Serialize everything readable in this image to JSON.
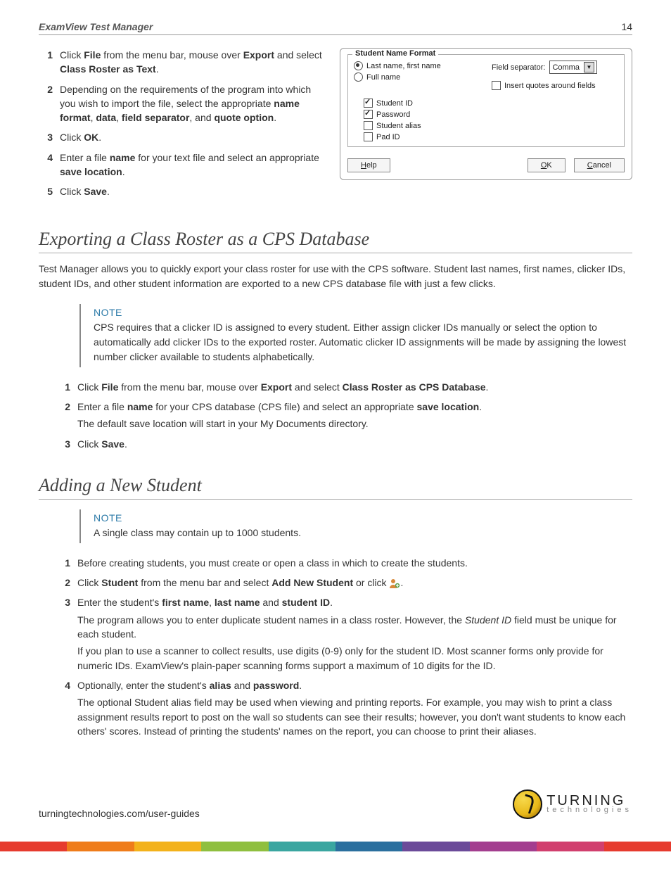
{
  "header": {
    "title": "ExamView Test Manager",
    "page": "14"
  },
  "top_steps": [
    {
      "n": "1",
      "html": "Click <strong>File</strong> from the menu bar, mouse over <strong>Export</strong> and select <strong>Class Roster as Text</strong>."
    },
    {
      "n": "2",
      "html": "Depending on the requirements of the program into which you wish to import the file, select the appropriate <strong>name format</strong>, <strong>data</strong>, <strong>field separator</strong>, and <strong>quote option</strong>."
    },
    {
      "n": "3",
      "html": "Click <strong>OK</strong>."
    },
    {
      "n": "4",
      "html": "Enter a file <strong>name</strong> for your text file and select an appropriate <strong>save location</strong>."
    },
    {
      "n": "5",
      "html": "Click <strong>Save</strong>."
    }
  ],
  "dialog": {
    "legend": "Student Name Format",
    "radio1": "Last name, first name",
    "radio2": "Full name",
    "field_sep_label": "Field separator:",
    "field_sep_value": "Comma",
    "insert_quotes": "Insert quotes around fields",
    "checks": [
      {
        "label": "Student ID",
        "checked": true
      },
      {
        "label": "Password",
        "checked": true
      },
      {
        "label": "Student alias",
        "checked": false
      },
      {
        "label": "Pad ID",
        "checked": false
      }
    ],
    "help": "Help",
    "ok": "OK",
    "cancel": "Cancel"
  },
  "section1": {
    "title": "Exporting a Class Roster as a CPS Database",
    "para": "Test Manager allows you to quickly export your class roster for use with the CPS software. Student last names, first names, clicker IDs, student IDs, and other student information are exported to a new CPS database file with just a few clicks.",
    "note_title": "NOTE",
    "note_body": "CPS requires that a clicker ID is assigned to every student. Either assign clicker IDs manually or select the option to automatically add clicker IDs to the exported roster. Automatic clicker ID assignments will be made by assigning the lowest number clicker available to students alphabetically.",
    "steps": [
      {
        "n": "1",
        "html": "Click <strong>File</strong> from the menu bar, mouse over <strong>Export</strong> and select <strong>Class Roster as CPS Database</strong>."
      },
      {
        "n": "2",
        "html": "Enter a file <strong>name</strong> for your CPS database (CPS file) and select an appropriate <strong>save location</strong>.",
        "p2": "The default save location will start in your My Documents directory."
      },
      {
        "n": "3",
        "html": "Click <strong>Save</strong>."
      }
    ]
  },
  "section2": {
    "title": "Adding a New Student",
    "note_title": "NOTE",
    "note_body": "A single class may contain up to 1000 students.",
    "steps": [
      {
        "n": "1",
        "html": "Before creating students, you must create or open a class in which to create the students."
      },
      {
        "n": "2",
        "html": "Click <strong>Student</strong> from the menu bar and select <strong>Add New Student</strong> or click <span class='icon-slot'></span>."
      },
      {
        "n": "3",
        "html": "Enter the student's <strong>first name</strong>, <strong>last name</strong> and <strong>student ID</strong>.",
        "p2": "The program allows you to enter duplicate student names in a class roster. However, the <em>Student ID</em> field must be unique for each student.",
        "p3": "If you plan to use a scanner to collect results, use digits (0-9) only for the student ID. Most scanner forms only provide for numeric IDs. ExamView's plain-paper scanning forms support a maximum of 10 digits for the ID."
      },
      {
        "n": "4",
        "html": "Optionally, enter the student's <strong>alias</strong> and <strong>password</strong>.",
        "p2": "The optional Student alias field may be used when viewing and printing reports. For example, you may wish to print a class assignment results report to post on the wall so students can see their results; however, you don't want students to know each others' scores. Instead of printing the students' names on the report, you can choose to print their aliases."
      }
    ]
  },
  "footer": {
    "url": "turningtechnologies.com/user-guides",
    "logo_top": "TURNING",
    "logo_bot": "technologies"
  },
  "strip_colors": [
    "#e63b2e",
    "#ef7c1a",
    "#f3b21b",
    "#8fbf3f",
    "#3aa6a0",
    "#2a6f9e",
    "#6b4a99",
    "#a33e8f",
    "#d13f6e",
    "#e63b2e"
  ]
}
